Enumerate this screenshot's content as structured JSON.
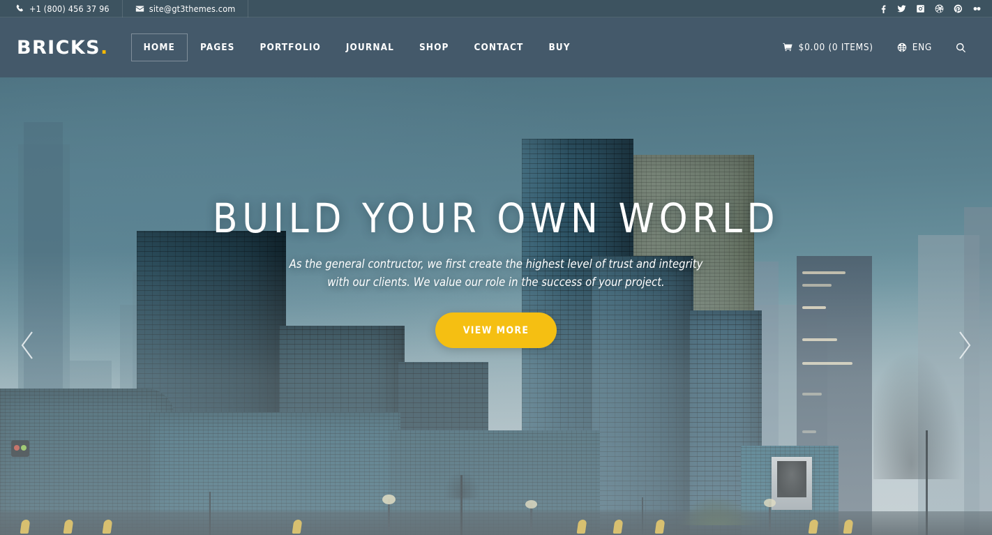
{
  "topbar": {
    "phone": "+1 (800) 456 37 96",
    "phone_icon": "phone-icon",
    "email": "site@gt3themes.com",
    "email_icon": "envelope-icon",
    "social": [
      {
        "name": "facebook-icon",
        "label": "Facebook"
      },
      {
        "name": "twitter-icon",
        "label": "Twitter"
      },
      {
        "name": "instagram-icon",
        "label": "Instagram"
      },
      {
        "name": "dribbble-icon",
        "label": "Dribbble"
      },
      {
        "name": "pinterest-icon",
        "label": "Pinterest"
      },
      {
        "name": "flickr-icon",
        "label": "Flickr"
      }
    ]
  },
  "header": {
    "logo_text": "BRICKS",
    "logo_dot": ".",
    "nav": [
      {
        "label": "HOME",
        "active": true
      },
      {
        "label": "PAGES",
        "active": false
      },
      {
        "label": "PORTFOLIO",
        "active": false
      },
      {
        "label": "JOURNAL",
        "active": false
      },
      {
        "label": "SHOP",
        "active": false
      },
      {
        "label": "CONTACT",
        "active": false
      },
      {
        "label": "BUY",
        "active": false
      }
    ],
    "cart_label": "$0.00 (0 ITEMS)",
    "cart_icon": "shopping-cart-icon",
    "language_label": "ENG",
    "language_icon": "globe-icon",
    "search_icon": "search-icon"
  },
  "hero": {
    "title": "BUILD YOUR OWN WORLD",
    "subtitle": "As the general contructor, we first create the highest level of trust and integrity with our clients. We value our role in the success of your project.",
    "button_label": "VIEW MORE",
    "prev_icon": "chevron-left-icon",
    "next_icon": "chevron-right-icon"
  },
  "colors": {
    "topbar_bg": "#3d5360",
    "header_bg": "#44596a",
    "accent_yellow": "#f5bf12",
    "logo_dot": "#f5b800",
    "text_white": "#ffffff",
    "sky_top": "#4d7281",
    "sky_bottom": "#cdd4d6"
  }
}
